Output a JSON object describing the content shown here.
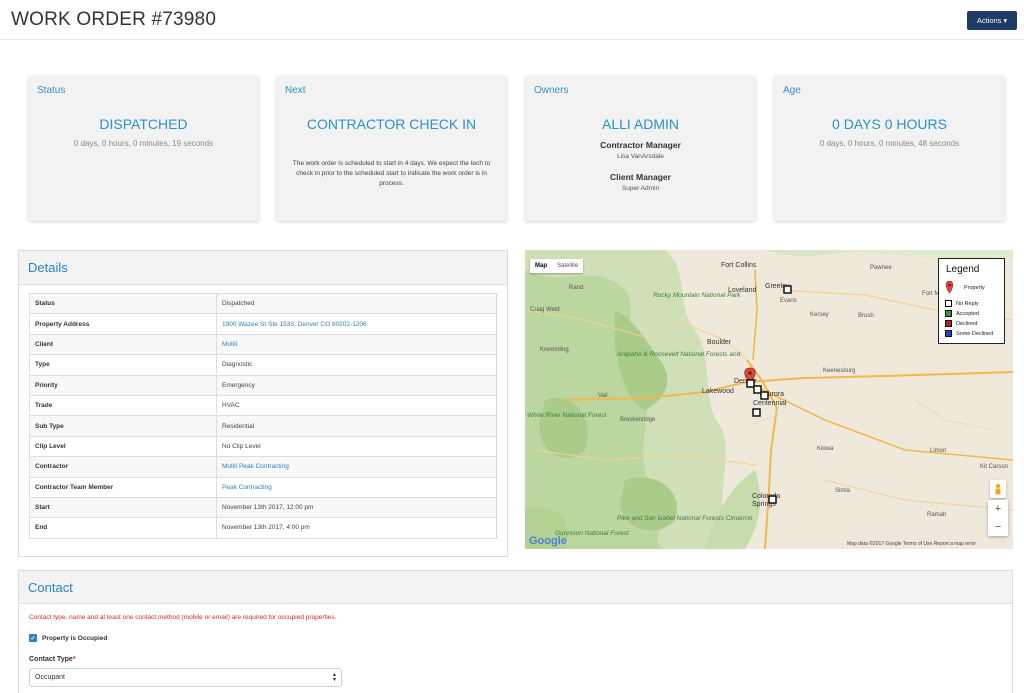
{
  "header": {
    "title": "WORK ORDER #73980",
    "actions_label": "Actions"
  },
  "cards": {
    "status": {
      "label": "Status",
      "value": "DISPATCHED",
      "sub": "0 days, 0 hours, 0 minutes, 19 seconds"
    },
    "next": {
      "label": "Next",
      "value": "CONTRACTOR CHECK IN",
      "desc": "The work order is scheduled to start in 4 days. We expect the tech to check in prior to the scheduled start to indicate the work order is in process."
    },
    "owners": {
      "label": "Owners",
      "value": "ALLI ADMIN",
      "contractor_manager_title": "Contractor Manager",
      "contractor_manager_name": "Lisa VanArsdale",
      "client_manager_title": "Client Manager",
      "client_manager_name": "Super Admin"
    },
    "age": {
      "label": "Age",
      "value": "0 DAYS 0 HOURS",
      "sub": "0 days, 0 hours, 0 minutes, 48 seconds"
    }
  },
  "details": {
    "title": "Details",
    "rows": [
      {
        "key": "Status",
        "value": "Dispatched"
      },
      {
        "key": "Property Address",
        "value": "1900 Wazee St Ste 1533, Denver CO 80202-1206"
      },
      {
        "key": "Client",
        "value": "Motili"
      },
      {
        "key": "Type",
        "value": "Diagnostic"
      },
      {
        "key": "Priority",
        "value": "Emergency"
      },
      {
        "key": "Trade",
        "value": "HVAC"
      },
      {
        "key": "Sub Type",
        "value": "Residential"
      },
      {
        "key": "Clip Level",
        "value": "No Clip Level"
      },
      {
        "key": "Contractor",
        "value": "Motili Peak Contracting"
      },
      {
        "key": "Contractor Team Member",
        "value": "Peak Contracting"
      },
      {
        "key": "Start",
        "value": "November 13th 2017, 12:00 pm"
      },
      {
        "key": "End",
        "value": "November 13th 2017, 4:00 pm"
      }
    ]
  },
  "map": {
    "tab_map": "Map",
    "tab_satellite": "Satellite",
    "legend_title": "Legend",
    "legend_items": [
      "Property",
      "No Reply",
      "Accepted",
      "Declined",
      "Some Declined"
    ],
    "legend_colors": {
      "property": "#d64a3f",
      "no_reply": "#000000",
      "accepted": "#2e9e2e",
      "declined": "#b3261e",
      "some_declined": "#2f3cc4"
    },
    "cities": [
      "Fort Collins",
      "Greeley",
      "Loveland",
      "Boulder",
      "Denver",
      "Lakewood",
      "Aurora",
      "Centennial",
      "Colorado Springs",
      "Evans",
      "Fort Morgan",
      "Brush"
    ],
    "green_labels": [
      "Rocky Mountain National Park",
      "Arapaho & Roosevelt National Forests and",
      "White River National Forest",
      "Pike and San Isabel National Forests Cimarron",
      "Gunnison National Forest"
    ],
    "small_labels": [
      "Rand",
      "Craig Weld",
      "Vail",
      "Breckenridge",
      "Kremmling",
      "Kersey",
      "Keenesburg",
      "Kiowa",
      "Limon",
      "Kit Carson",
      "Pawnee",
      "Ramah",
      "Simla"
    ],
    "attribution": "Map data ©2017 Google   Terms of Use   Report a map error",
    "logo": "Google"
  },
  "contact": {
    "title": "Contact",
    "warning": "Contact type, name and at least one contact method (mobile or email) are required for occupied properties.",
    "checkbox_label": "Property is Occupied",
    "checkbox_checked": true,
    "type_label": "Contact Type",
    "type_required": "*",
    "type_value": "Occupant"
  }
}
